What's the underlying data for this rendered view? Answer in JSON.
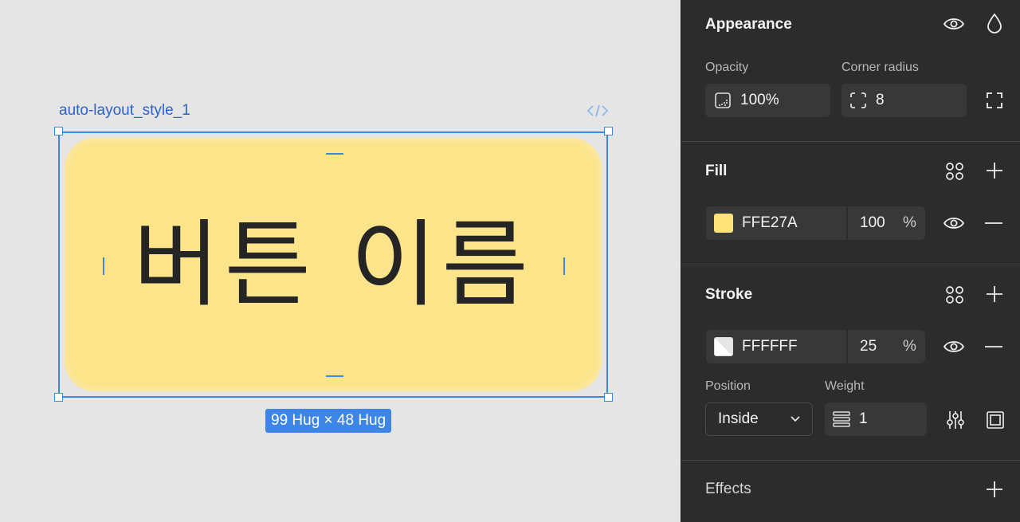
{
  "canvas": {
    "frame_name": "auto-layout_style_1",
    "button_text": "버튼 이름",
    "size_badge": "99 Hug × 48 Hug"
  },
  "panel": {
    "appearance": {
      "title": "Appearance",
      "opacity_label": "Opacity",
      "opacity_value": "100%",
      "corner_label": "Corner radius",
      "corner_value": "8"
    },
    "fill": {
      "title": "Fill",
      "hex": "FFE27A",
      "opacity": "100",
      "percent": "%",
      "color": "#FFE27A"
    },
    "stroke": {
      "title": "Stroke",
      "hex": "FFFFFF",
      "opacity": "25",
      "percent": "%",
      "color": "#FFFFFF",
      "position_label": "Position",
      "position_value": "Inside",
      "weight_label": "Weight",
      "weight_value": "1"
    },
    "effects": {
      "title": "Effects"
    }
  },
  "colors": {
    "selection_blue": "#3D86E8",
    "panel_bg": "#2C2C2C",
    "field_bg": "#383838"
  }
}
